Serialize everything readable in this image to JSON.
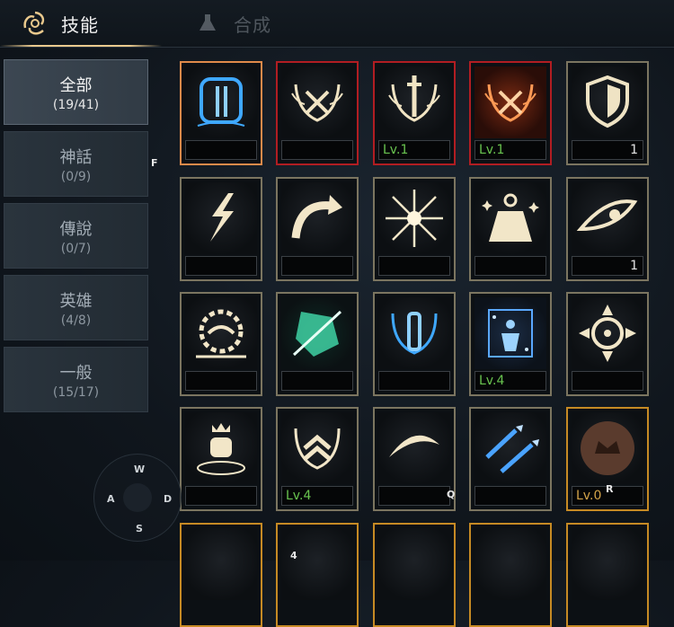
{
  "tabs": [
    {
      "label": "技能",
      "icon": "skill-spiral-icon",
      "active": true
    },
    {
      "label": "合成",
      "icon": "flask-icon",
      "active": false
    }
  ],
  "categories": [
    {
      "name": "全部",
      "count": "(19/41)",
      "active": true
    },
    {
      "name": "神話",
      "count": "(0/9)",
      "active": false
    },
    {
      "name": "傳說",
      "count": "(0/7)",
      "active": false
    },
    {
      "name": "英雄",
      "count": "(4/8)",
      "active": false
    },
    {
      "name": "一般",
      "count": "(15/17)",
      "active": false
    }
  ],
  "skills": [
    [
      {
        "icon": "blue-pillar-icon",
        "level": "",
        "count": ""
      },
      {
        "icon": "crossed-swords-antlers-icon",
        "level": "",
        "count": ""
      },
      {
        "icon": "sword-antlers-icon",
        "level": "Lv.1",
        "count": ""
      },
      {
        "icon": "red-crossed-swords-icon",
        "level": "Lv.1",
        "count": ""
      },
      {
        "icon": "shield-icon",
        "level": "",
        "count": "1"
      }
    ],
    [
      {
        "icon": "lightning-bolt-icon",
        "level": "",
        "count": ""
      },
      {
        "icon": "curved-arrow-icon",
        "level": "",
        "count": ""
      },
      {
        "icon": "starburst-icon",
        "level": "",
        "count": ""
      },
      {
        "icon": "weight-icon",
        "level": "",
        "count": ""
      },
      {
        "icon": "eye-icon",
        "level": "",
        "count": "1"
      }
    ],
    [
      {
        "icon": "thorn-wreath-icon",
        "level": "",
        "count": ""
      },
      {
        "icon": "green-slash-icon",
        "level": "",
        "count": ""
      },
      {
        "icon": "blue-pillar-antler-icon",
        "level": "",
        "count": ""
      },
      {
        "icon": "blue-figure-icon",
        "level": "Lv.4",
        "count": ""
      },
      {
        "icon": "crosshair-compass-icon",
        "level": "",
        "count": ""
      }
    ],
    [
      {
        "icon": "crowned-fist-icon",
        "level": "",
        "count": ""
      },
      {
        "icon": "chevron-antlers-icon",
        "level": "Lv.4",
        "count": ""
      },
      {
        "icon": "wing-swoosh-icon",
        "level": "",
        "count": ""
      },
      {
        "icon": "blue-arrows-icon",
        "level": "",
        "count": ""
      },
      {
        "icon": "crown-coin-icon",
        "level": "Lv.0",
        "count": ""
      }
    ]
  ],
  "key_hints": {
    "f": "F",
    "q": "Q",
    "r": "R",
    "num": "4"
  },
  "joystick": {
    "up": "W",
    "left": "A",
    "right": "D",
    "down": "S"
  },
  "colors": {
    "level_green": "#69c44f",
    "gold_border": "#c68a24",
    "red_border": "#b11d22",
    "accent": "#e9c98d"
  }
}
